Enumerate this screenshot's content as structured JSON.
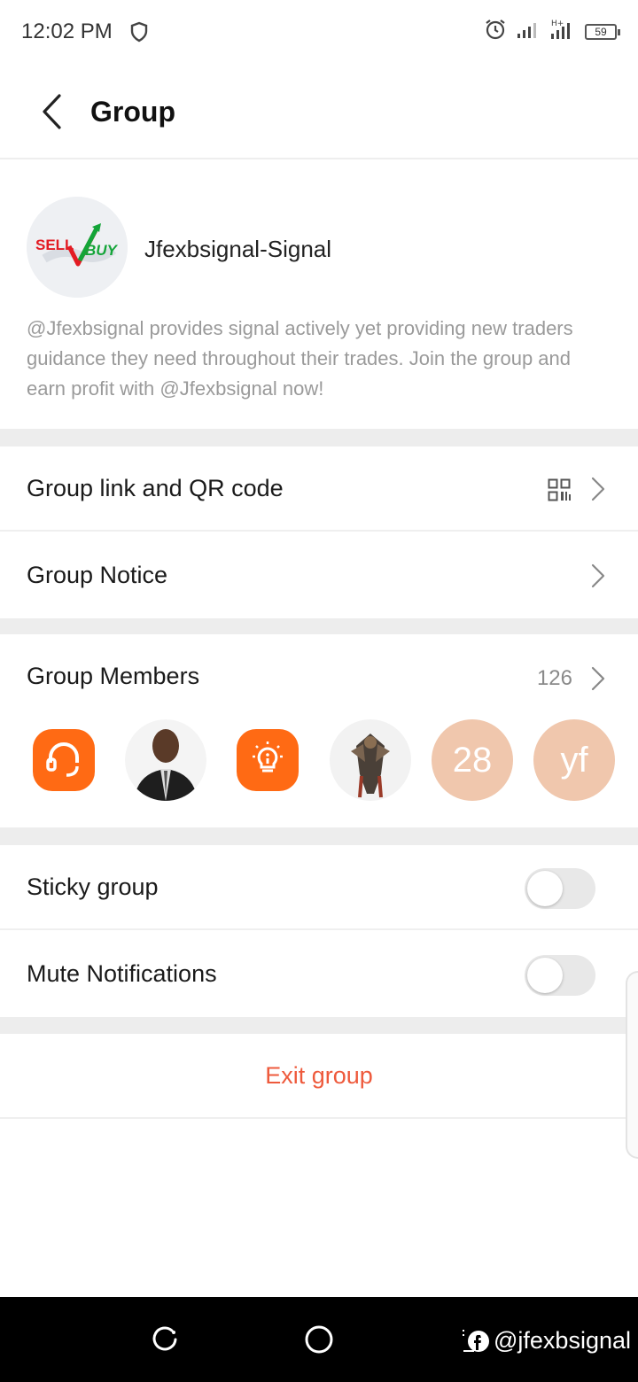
{
  "status_bar": {
    "time": "12:02 PM",
    "battery": "59"
  },
  "header": {
    "title": "Group"
  },
  "group": {
    "name": "Jfexbsignal-Signal",
    "logo_sell": "SELL",
    "logo_buy": "BUY",
    "description": "@Jfexbsignal provides signal actively yet providing new traders guidance they need throughout their trades. Join the group and earn profit with @Jfexbsignal now!"
  },
  "settings": {
    "group_link_label": "Group link and QR code",
    "group_notice_label": "Group Notice",
    "group_members_label": "Group Members",
    "group_members_count": "126",
    "sticky_group_label": "Sticky group",
    "sticky_group_on": false,
    "mute_notifications_label": "Mute Notifications",
    "mute_notifications_on": false,
    "exit_label": "Exit group"
  },
  "members": [
    {
      "type": "icon",
      "icon": "headset-icon"
    },
    {
      "type": "photo",
      "icon": "person-photo"
    },
    {
      "type": "icon",
      "icon": "lightbulb-icon"
    },
    {
      "type": "photo",
      "icon": "warrior-artwork"
    },
    {
      "type": "initials",
      "text": "28"
    },
    {
      "type": "initials",
      "text": "yf"
    }
  ],
  "watermark": {
    "text": "@jfexbsignal"
  },
  "colors": {
    "accent_orange": "#ff6a14",
    "exit_red": "#ee5a3c",
    "peach_avatar": "#f0c7ad"
  }
}
